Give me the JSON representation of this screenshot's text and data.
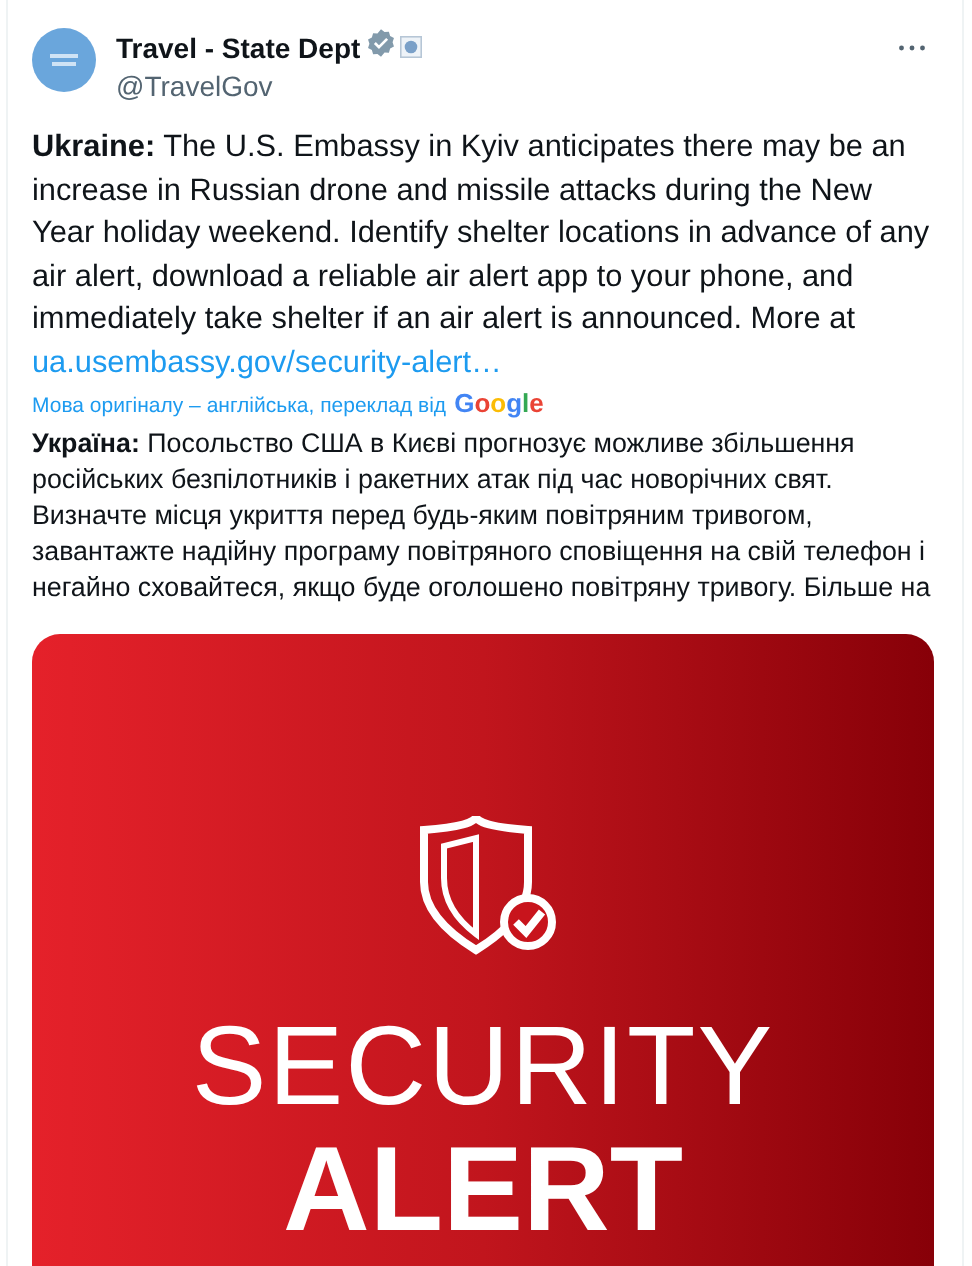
{
  "post": {
    "author": {
      "name": "Travel - State Dept",
      "handle": "@TravelGov",
      "verified": true
    },
    "text": "**Ukraine:** The U.S. Embassy in Kyiv anticipates there may be an increase in Russian drone and missile attacks during the New Year holiday weekend. Identify shelter locations in advance of any air alert, download a reliable air alert app to your phone, and immediately take shelter if an air alert is announced. More at ",
    "link": "ua.usembassy.gov/security-alert…",
    "translation_note": "Мова оригіналу – англійська, переклад від",
    "translation_provider": "Google",
    "translation": "**Україна:** Посольство США в Києві прогнозує можливе збільшення російських безпілотників і ракетних атак під час новорічних свят. Визначте місця укриття перед будь-яким повітряним тривогом, завантажте надійну програму повітряного сповіщення на свій телефон і негайно сховайтеся, якщо буде оголошено повітряну тривогу. Більше на",
    "image": {
      "title": "SECURITY",
      "subtitle": "ALERT"
    }
  }
}
